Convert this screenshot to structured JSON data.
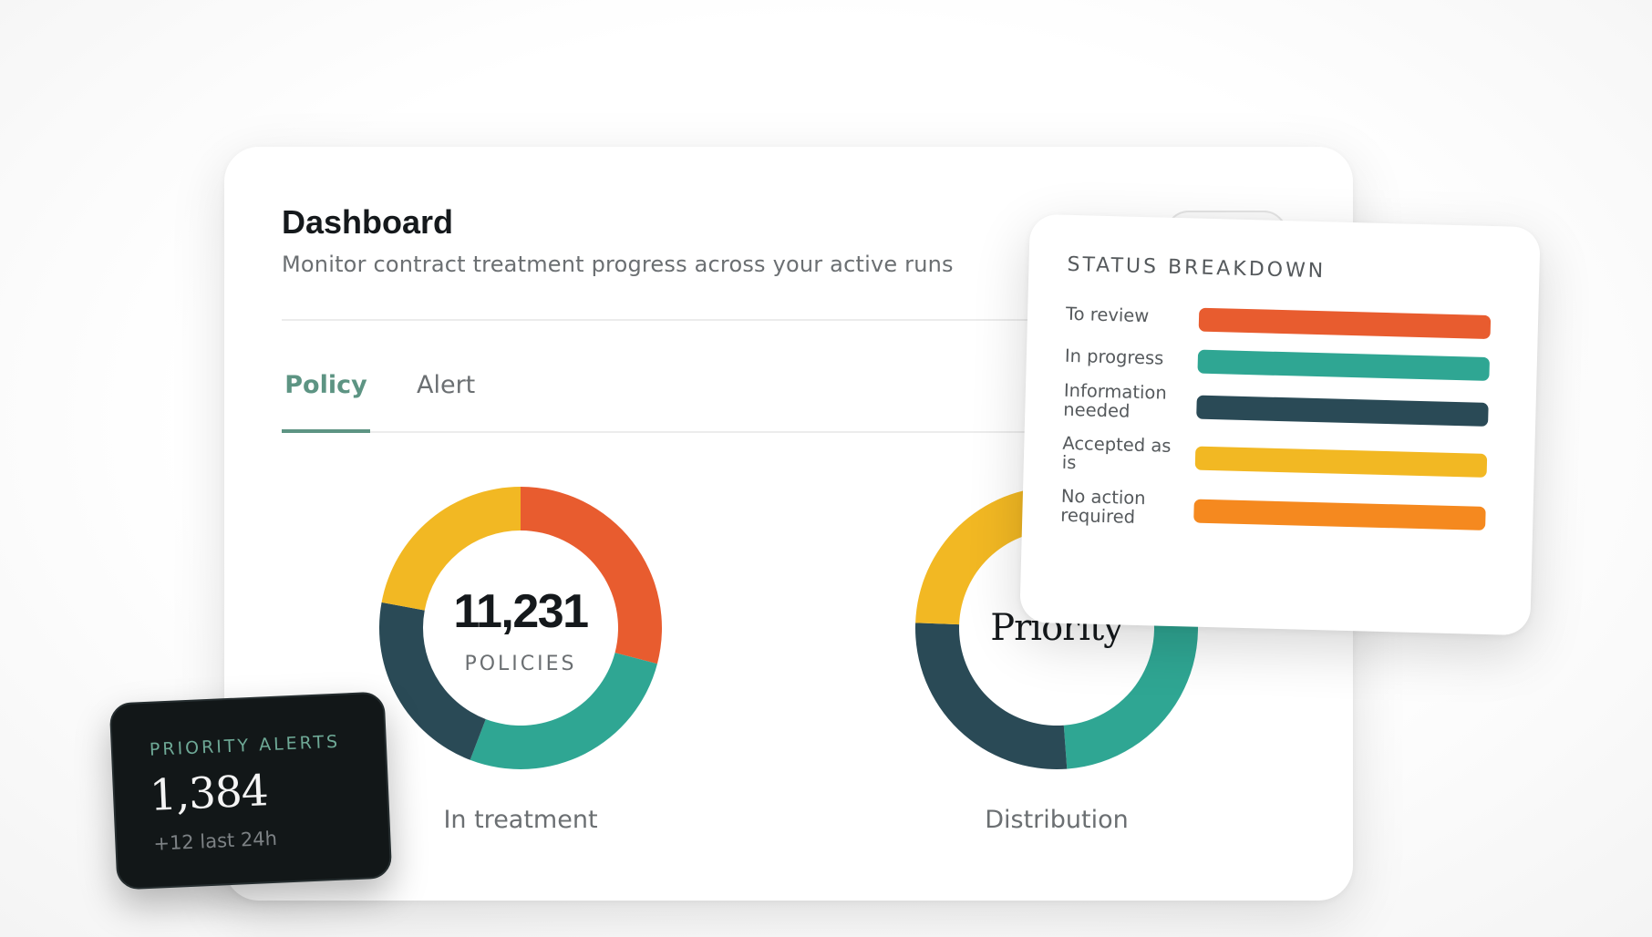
{
  "header": {
    "title": "Dashboard",
    "subtitle": "Monitor contract treatment progress across your active runs"
  },
  "tabs": [
    {
      "label": "Policy",
      "active": true
    },
    {
      "label": "Alert",
      "active": false
    }
  ],
  "charts": {
    "treatment": {
      "center_value": "11,231",
      "center_unit": "POLICIES",
      "caption": "In treatment"
    },
    "distribution": {
      "center_label": "Priority",
      "caption": "Distribution"
    }
  },
  "chart_data": [
    {
      "type": "pie",
      "categories": [
        "To review",
        "In progress",
        "Information needed",
        "Accepted as is"
      ],
      "values": [
        25,
        23,
        19,
        19
      ],
      "colors": [
        "#e85c2f",
        "#2fa693",
        "#2a4a56",
        "#f2b823"
      ]
    },
    {
      "type": "pie",
      "categories": [
        "To review",
        "In progress",
        "Information needed",
        "Accepted as is"
      ],
      "values": [
        15,
        27,
        23,
        21
      ],
      "colors": [
        "#e85c2f",
        "#2fa693",
        "#2a4a56",
        "#f2b823"
      ]
    }
  ],
  "status_breakdown": {
    "title": "STATUS BREAKDOWN",
    "items": [
      {
        "label": "To review",
        "color": "#e85c2f"
      },
      {
        "label": "In progress",
        "color": "#2fa693"
      },
      {
        "label": "Information needed",
        "color": "#2a4a56"
      },
      {
        "label": "Accepted as is",
        "color": "#f2b823"
      },
      {
        "label": "No action required",
        "color": "#f5891f"
      }
    ]
  },
  "priority_alerts": {
    "title": "PRIORITY ALERTS",
    "value": "1,384",
    "delta": "+12 last 24h"
  }
}
